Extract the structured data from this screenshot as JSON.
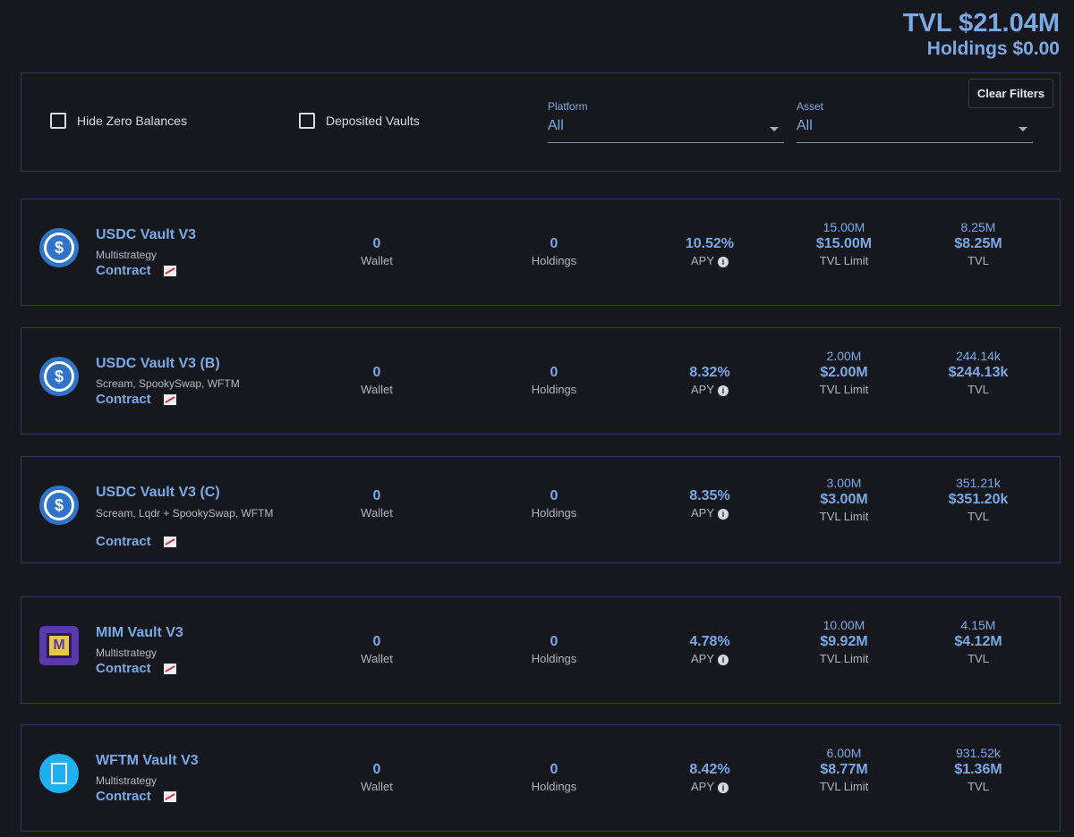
{
  "summary": {
    "tvl": "TVL $21.04M",
    "holdings": "Holdings $0.00"
  },
  "filters": {
    "hide_zero": "Hide Zero Balances",
    "deposited": "Deposited Vaults",
    "platform_label": "Platform",
    "platform_value": "All",
    "asset_label": "Asset",
    "asset_value": "All",
    "clear": "Clear Filters"
  },
  "labels": {
    "wallet": "Wallet",
    "holdings": "Holdings",
    "apy": "APY",
    "tvl_limit": "TVL Limit",
    "tvl": "TVL",
    "contract": "Contract"
  },
  "vaults": [
    {
      "name": "USDC Vault V3",
      "sub": "Multistrategy",
      "icon": "usdc-icon",
      "wallet": "0",
      "holdings": "0",
      "apy": "10.52%",
      "limit_top": "15.00M",
      "limit": "$15.00M",
      "tvl_top": "8.25M",
      "tvl": "$8.25M"
    },
    {
      "name": "USDC Vault V3 (B)",
      "sub": "Scream, SpookySwap, WFTM",
      "icon": "usdc-icon",
      "wallet": "0",
      "holdings": "0",
      "apy": "8.32%",
      "limit_top": "2.00M",
      "limit": "$2.00M",
      "tvl_top": "244.14k",
      "tvl": "$244.13k"
    },
    {
      "name": "USDC Vault V3 (C)",
      "sub": "Scream, Lqdr + SpookySwap, WFTM",
      "icon": "usdc-icon",
      "wallet": "0",
      "holdings": "0",
      "apy": "8.35%",
      "limit_top": "3.00M",
      "limit": "$3.00M",
      "tvl_top": "351.21k",
      "tvl": "$351.20k"
    },
    {
      "name": "MIM Vault V3",
      "sub": "Multistrategy",
      "icon": "mim-icon",
      "wallet": "0",
      "holdings": "0",
      "apy": "4.78%",
      "limit_top": "10.00M",
      "limit": "$9.92M",
      "tvl_top": "4.15M",
      "tvl": "$4.12M"
    },
    {
      "name": "WFTM Vault V3",
      "sub": "Multistrategy",
      "icon": "wftm-icon",
      "wallet": "0",
      "holdings": "0",
      "apy": "8.42%",
      "limit_top": "6.00M",
      "limit": "$8.77M",
      "tvl_top": "931.52k",
      "tvl": "$1.36M"
    }
  ]
}
